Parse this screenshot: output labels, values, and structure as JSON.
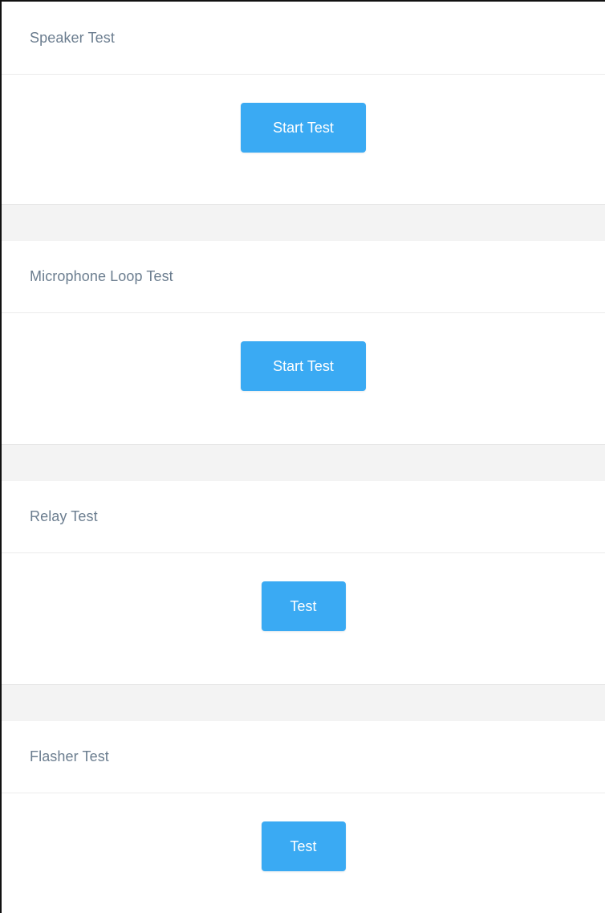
{
  "sections": [
    {
      "title": "Speaker Test",
      "button_label": "Start Test"
    },
    {
      "title": "Microphone Loop Test",
      "button_label": "Start Test"
    },
    {
      "title": "Relay Test",
      "button_label": "Test"
    },
    {
      "title": "Flasher Test",
      "button_label": "Test"
    }
  ],
  "colors": {
    "button_bg": "#3aaaf3",
    "title_text": "#6b7d8f",
    "gap_bg": "#f3f3f3"
  }
}
